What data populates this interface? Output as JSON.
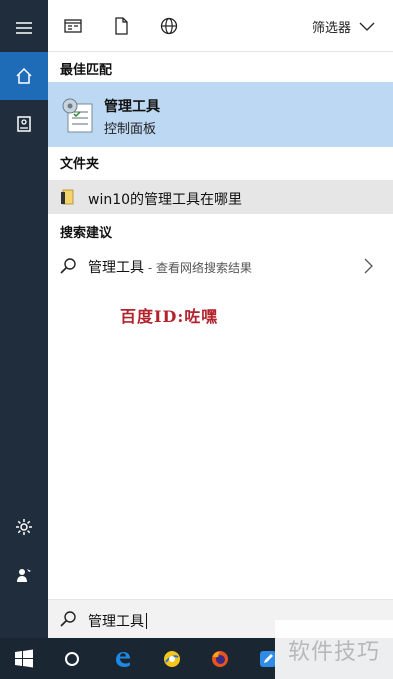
{
  "topbar": {
    "filter_label": "筛选器",
    "icons": [
      "app-icon",
      "document-icon",
      "web-icon",
      "chevron-down-icon"
    ]
  },
  "sections": {
    "best_match_title": "最佳匹配",
    "folders_title": "文件夹",
    "suggestions_title": "搜索建议"
  },
  "best_match": {
    "title": "管理工具",
    "subtitle": "控制面板",
    "icon": "admin-tools-icon"
  },
  "folder_result": {
    "label": "win10的管理工具在哪里",
    "icon": "folder-icon"
  },
  "suggestion": {
    "label": "管理工具",
    "secondary": " - 查看网络搜索结果",
    "icon": "search-icon"
  },
  "search": {
    "value": "管理工具"
  },
  "watermarks": {
    "baidu": "百度ID:咗嘿",
    "corner": "软件技巧"
  },
  "rail": {
    "icons": [
      "menu-icon",
      "home-icon",
      "notebook-icon",
      "settings-icon",
      "feedback-icon"
    ]
  },
  "taskbar": {
    "icons": [
      "windows-start-icon",
      "cortana-icon",
      "edge-icon",
      "qq-browser-icon",
      "firefox-icon",
      "pen-icon"
    ]
  },
  "colors": {
    "rail_bg": "#1f2d3d",
    "rail_active": "#1e6bb8",
    "best_match_bg": "#bcd8f2",
    "folder_row_bg": "#e6e6e6",
    "taskbar_bg": "#1b2633"
  }
}
